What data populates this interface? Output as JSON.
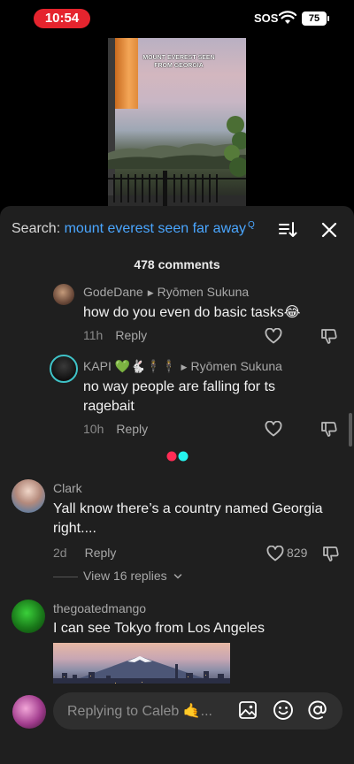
{
  "status": {
    "time": "10:54",
    "sos": "SOS",
    "battery": "75"
  },
  "video": {
    "caption": "MOUNT EVEREST SEEN FROM GEORGIA"
  },
  "search": {
    "prefix": "Search: ",
    "query": "mount everest seen far away",
    "sup": "Q"
  },
  "comments_header": {
    "count": "478 comments"
  },
  "icons": {
    "sort": "sort-icon",
    "close": "close-icon",
    "like": "heart-outline-icon",
    "dislike": "thumb-down-outline-icon",
    "image": "image-icon",
    "emoji": "emoji-icon",
    "mention": "at-icon",
    "chevron": "chevron-down-icon"
  },
  "comments": [
    {
      "author": "GodeDane",
      "reply_to": "Ryōmen Sukuna",
      "text": "how do you even do basic tasks😂",
      "time": "11h",
      "reply": "Reply"
    },
    {
      "author": "KAPI 💚🐇🕴🕴",
      "reply_to": "Ryōmen Sukuna",
      "text": "no way people are falling for ts ragebait",
      "time": "10h",
      "reply": "Reply"
    },
    {
      "author": "Clark",
      "text": "Yall know there’s a country named Georgia right....",
      "time": "2d",
      "reply": "Reply",
      "likes": "829",
      "view_replies": "View 16 replies"
    },
    {
      "author": "thegoatedmango",
      "text": "I can see Tokyo from Los Angeles"
    }
  ],
  "input": {
    "placeholder": "Replying to Caleb 🤙..."
  },
  "colors": {
    "accent_blue": "#4aa6ff",
    "sheet_bg": "#1f1f1f",
    "time_pill": "#e5242e",
    "loader_red": "#fe2c55",
    "loader_cyan": "#25f4ee"
  }
}
